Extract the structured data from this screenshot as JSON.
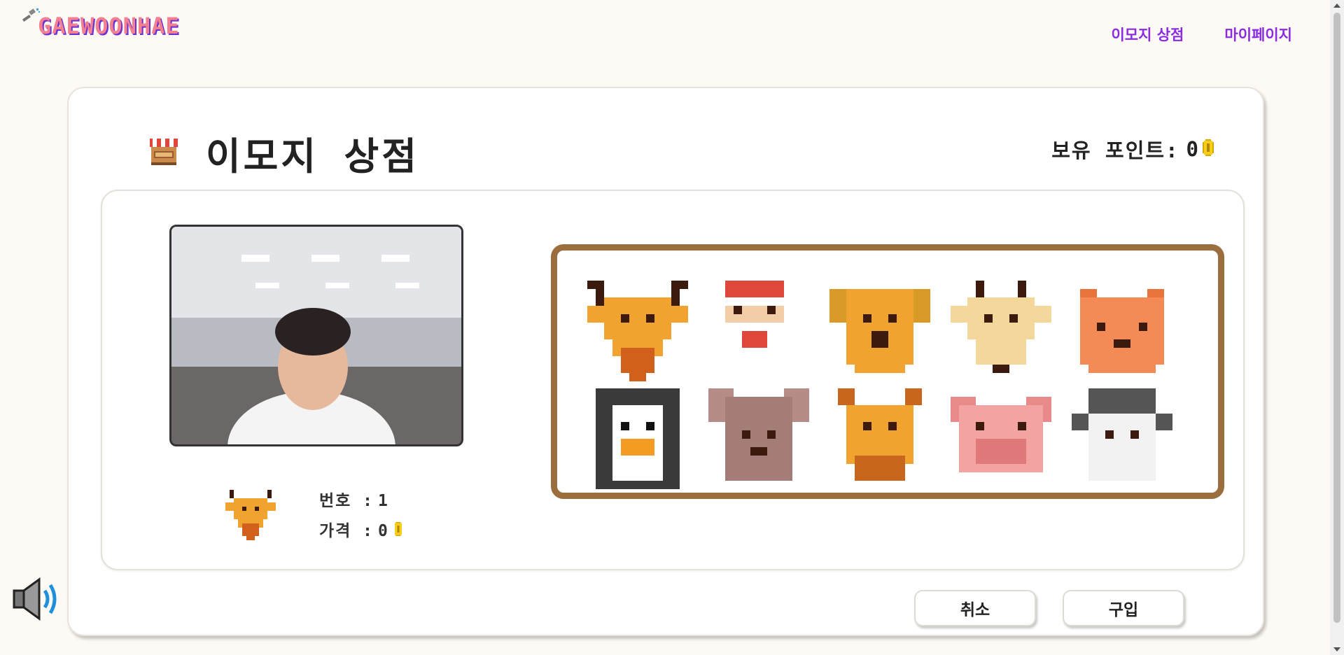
{
  "header": {
    "logo_text": "GAEWOONHAE",
    "nav": [
      {
        "label": "이모지 상점"
      },
      {
        "label": "마이페이지"
      }
    ]
  },
  "shop": {
    "title": "이모지 상점",
    "points_label": "보유 포인트:",
    "points_value": "0"
  },
  "selected": {
    "number_label": "번호 :",
    "number_value": "1",
    "price_label": "가격 :",
    "price_value": "0"
  },
  "emojis": [
    {
      "name": "deer"
    },
    {
      "name": "santa"
    },
    {
      "name": "dog"
    },
    {
      "name": "goat"
    },
    {
      "name": "tiger"
    },
    {
      "name": "penguin"
    },
    {
      "name": "mouse"
    },
    {
      "name": "giraffe"
    },
    {
      "name": "pig"
    },
    {
      "name": "sheep"
    }
  ],
  "buttons": {
    "cancel": "취소",
    "buy": "구입"
  },
  "colors": {
    "accent": "#8a2be2",
    "logo": "#f47f8e",
    "frame": "#9a6e3f"
  }
}
